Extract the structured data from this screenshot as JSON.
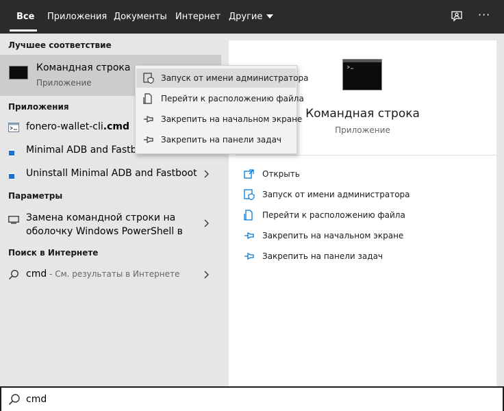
{
  "tabs": [
    {
      "label": "Все",
      "active": true
    },
    {
      "label": "Приложения"
    },
    {
      "label": "Документы"
    },
    {
      "label": "Интернет"
    },
    {
      "label": "Другие"
    }
  ],
  "top_icons": {
    "feedback": "feedback-icon",
    "more": "···"
  },
  "left": {
    "best_match_title": "Лучшее соответствие",
    "best_match": {
      "title": "Командная строка",
      "subtitle": "Приложение",
      "icon": "terminal-icon"
    },
    "apps_title": "Приложения",
    "apps": [
      {
        "name": "fonero-wallet-cli",
        "suffix": ".cmd",
        "icon": "script-file-icon"
      },
      {
        "name": "Minimal ADB and Fastboot",
        "icon": "adb-app-icon"
      },
      {
        "name": "Uninstall Minimal ADB and Fastboot",
        "icon": "adb-app-icon"
      }
    ],
    "settings_title": "Параметры",
    "settings": [
      {
        "line1": "Замена командной строки на",
        "line2": "оболочку Windows PowerShell в",
        "icon": "monitor-icon"
      }
    ],
    "web_title": "Поиск в Интернете",
    "web": {
      "query": "cmd",
      "hint": " - См. результаты в Интернете",
      "icon": "search-icon"
    }
  },
  "context_menu": [
    {
      "label": "Запуск от имени администратора",
      "icon": "shield-icon",
      "hover": true
    },
    {
      "label": "Перейти к расположению файла",
      "icon": "file-location-icon"
    },
    {
      "label": "Закрепить на начальном экране",
      "icon": "pin-icon"
    },
    {
      "label": "Закрепить на панели задач",
      "icon": "pin-icon"
    }
  ],
  "right": {
    "title": "Командная строка",
    "subtitle": "Приложение",
    "actions": [
      {
        "label": "Открыть",
        "icon": "open-icon"
      },
      {
        "label": "Запуск от имени администратора",
        "icon": "shield-icon"
      },
      {
        "label": "Перейти к расположению файла",
        "icon": "file-location-icon"
      },
      {
        "label": "Закрепить на начальном экране",
        "icon": "pin-icon"
      },
      {
        "label": "Закрепить на панели задач",
        "icon": "pin-icon"
      }
    ]
  },
  "search": {
    "value": "cmd"
  },
  "colors": {
    "accent": "#0078d7",
    "topbar": "#2b2b2b",
    "panel": "#e6e6e6"
  }
}
